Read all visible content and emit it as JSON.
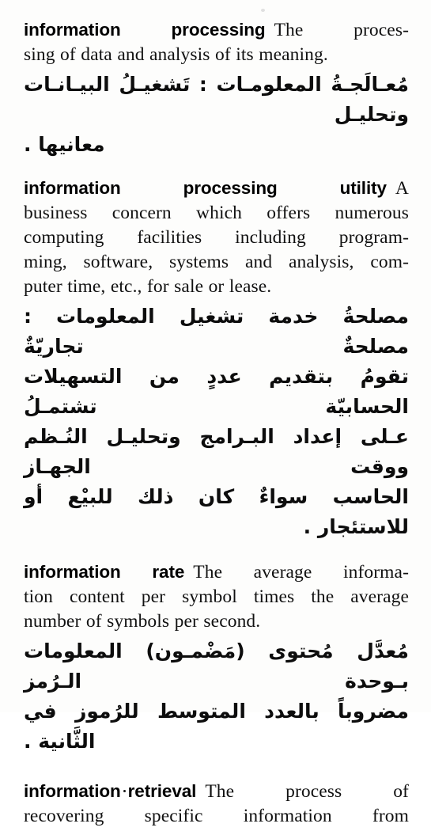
{
  "page": {
    "type": "scanned-dictionary-page",
    "language_pair": "English–Arabic",
    "background_color": "#fdfdfc",
    "text_color": "#111111",
    "column_count": 1
  },
  "entries": [
    {
      "id": "information-processing",
      "headword": "information processing",
      "english_definition": "The processing of data and analysis of its meaning.",
      "english_lines": [
        "The proces-",
        "sing of data and analysis of its meaning."
      ],
      "arabic_definition": "مُعالَجَةُ المعلومات: تَشغيلُ البيانات وتحليل معانيها.",
      "arabic_lines": [
        "مُعـالَجـةُ المعلومـات : تَشغيـلُ البيـانـات وتحليـل",
        "معانيها ."
      ]
    },
    {
      "id": "information-processing-utility",
      "headword": "information processing utility",
      "english_definition": "A business concern which offers numerous computing facilities including programming, software, systems and analysis, computer time, etc., for sale or lease.",
      "english_lines": [
        "A",
        "business concern which offers numerous",
        "computing facilities including program-",
        "ming, software, systems and analysis, com-",
        "puter time, etc., for sale or lease."
      ],
      "arabic_definition": "مصلحةُ خدمة تشغيل المعلومات: مصلحةٌ تجاريةٌ تقومُ بتقديم عددٍ من التسهيلات الحسابيّة تشتملُ على إعداد البرامج وتحليل النُظم ووقت الجهاز الحاسب سواءٌ كان ذلك للبيْع أو للاستئجار.",
      "arabic_lines": [
        "مصلحةُ خدمة تشغيل المعلومات : مصلحةٌ تجاريّةٌ",
        "تقومُ بتقديم عددٍ من التسهيلات الحسابيّة تشتمـلُ",
        "عـلى إعداد البـرامج وتحليـل النُـظم ووقت الجهـاز",
        "الحاسب سواءٌ كان ذلك للبيْع أو للاستئجار ."
      ]
    },
    {
      "id": "information-rate",
      "headword": "information rate",
      "english_definition": "The average information content per symbol times the average number of symbols per second.",
      "english_lines": [
        "The average informa-",
        "tion content per symbol times the average",
        "number of symbols per second."
      ],
      "arabic_definition": "مُعدَّل مُحتوى (مَضْمون) المعلومات بوحدة الرَّمز مضروباً بالعدد المتوسط للرُموز في الثَّانية.",
      "arabic_lines": [
        "مُعدَّل مُحتوى (مَضْمـون) المعلومات بـوحدة الـرُمز",
        "مضروباً بالعدد المتوسط للرُموز في الثَّانية ."
      ]
    },
    {
      "id": "information-retrieval",
      "headword": "information retrieval",
      "english_definition": "The process of recovering specific information from",
      "english_lines": [
        "The process of",
        "recovering specific information from"
      ],
      "arabic_definition": "",
      "arabic_lines": []
    }
  ]
}
